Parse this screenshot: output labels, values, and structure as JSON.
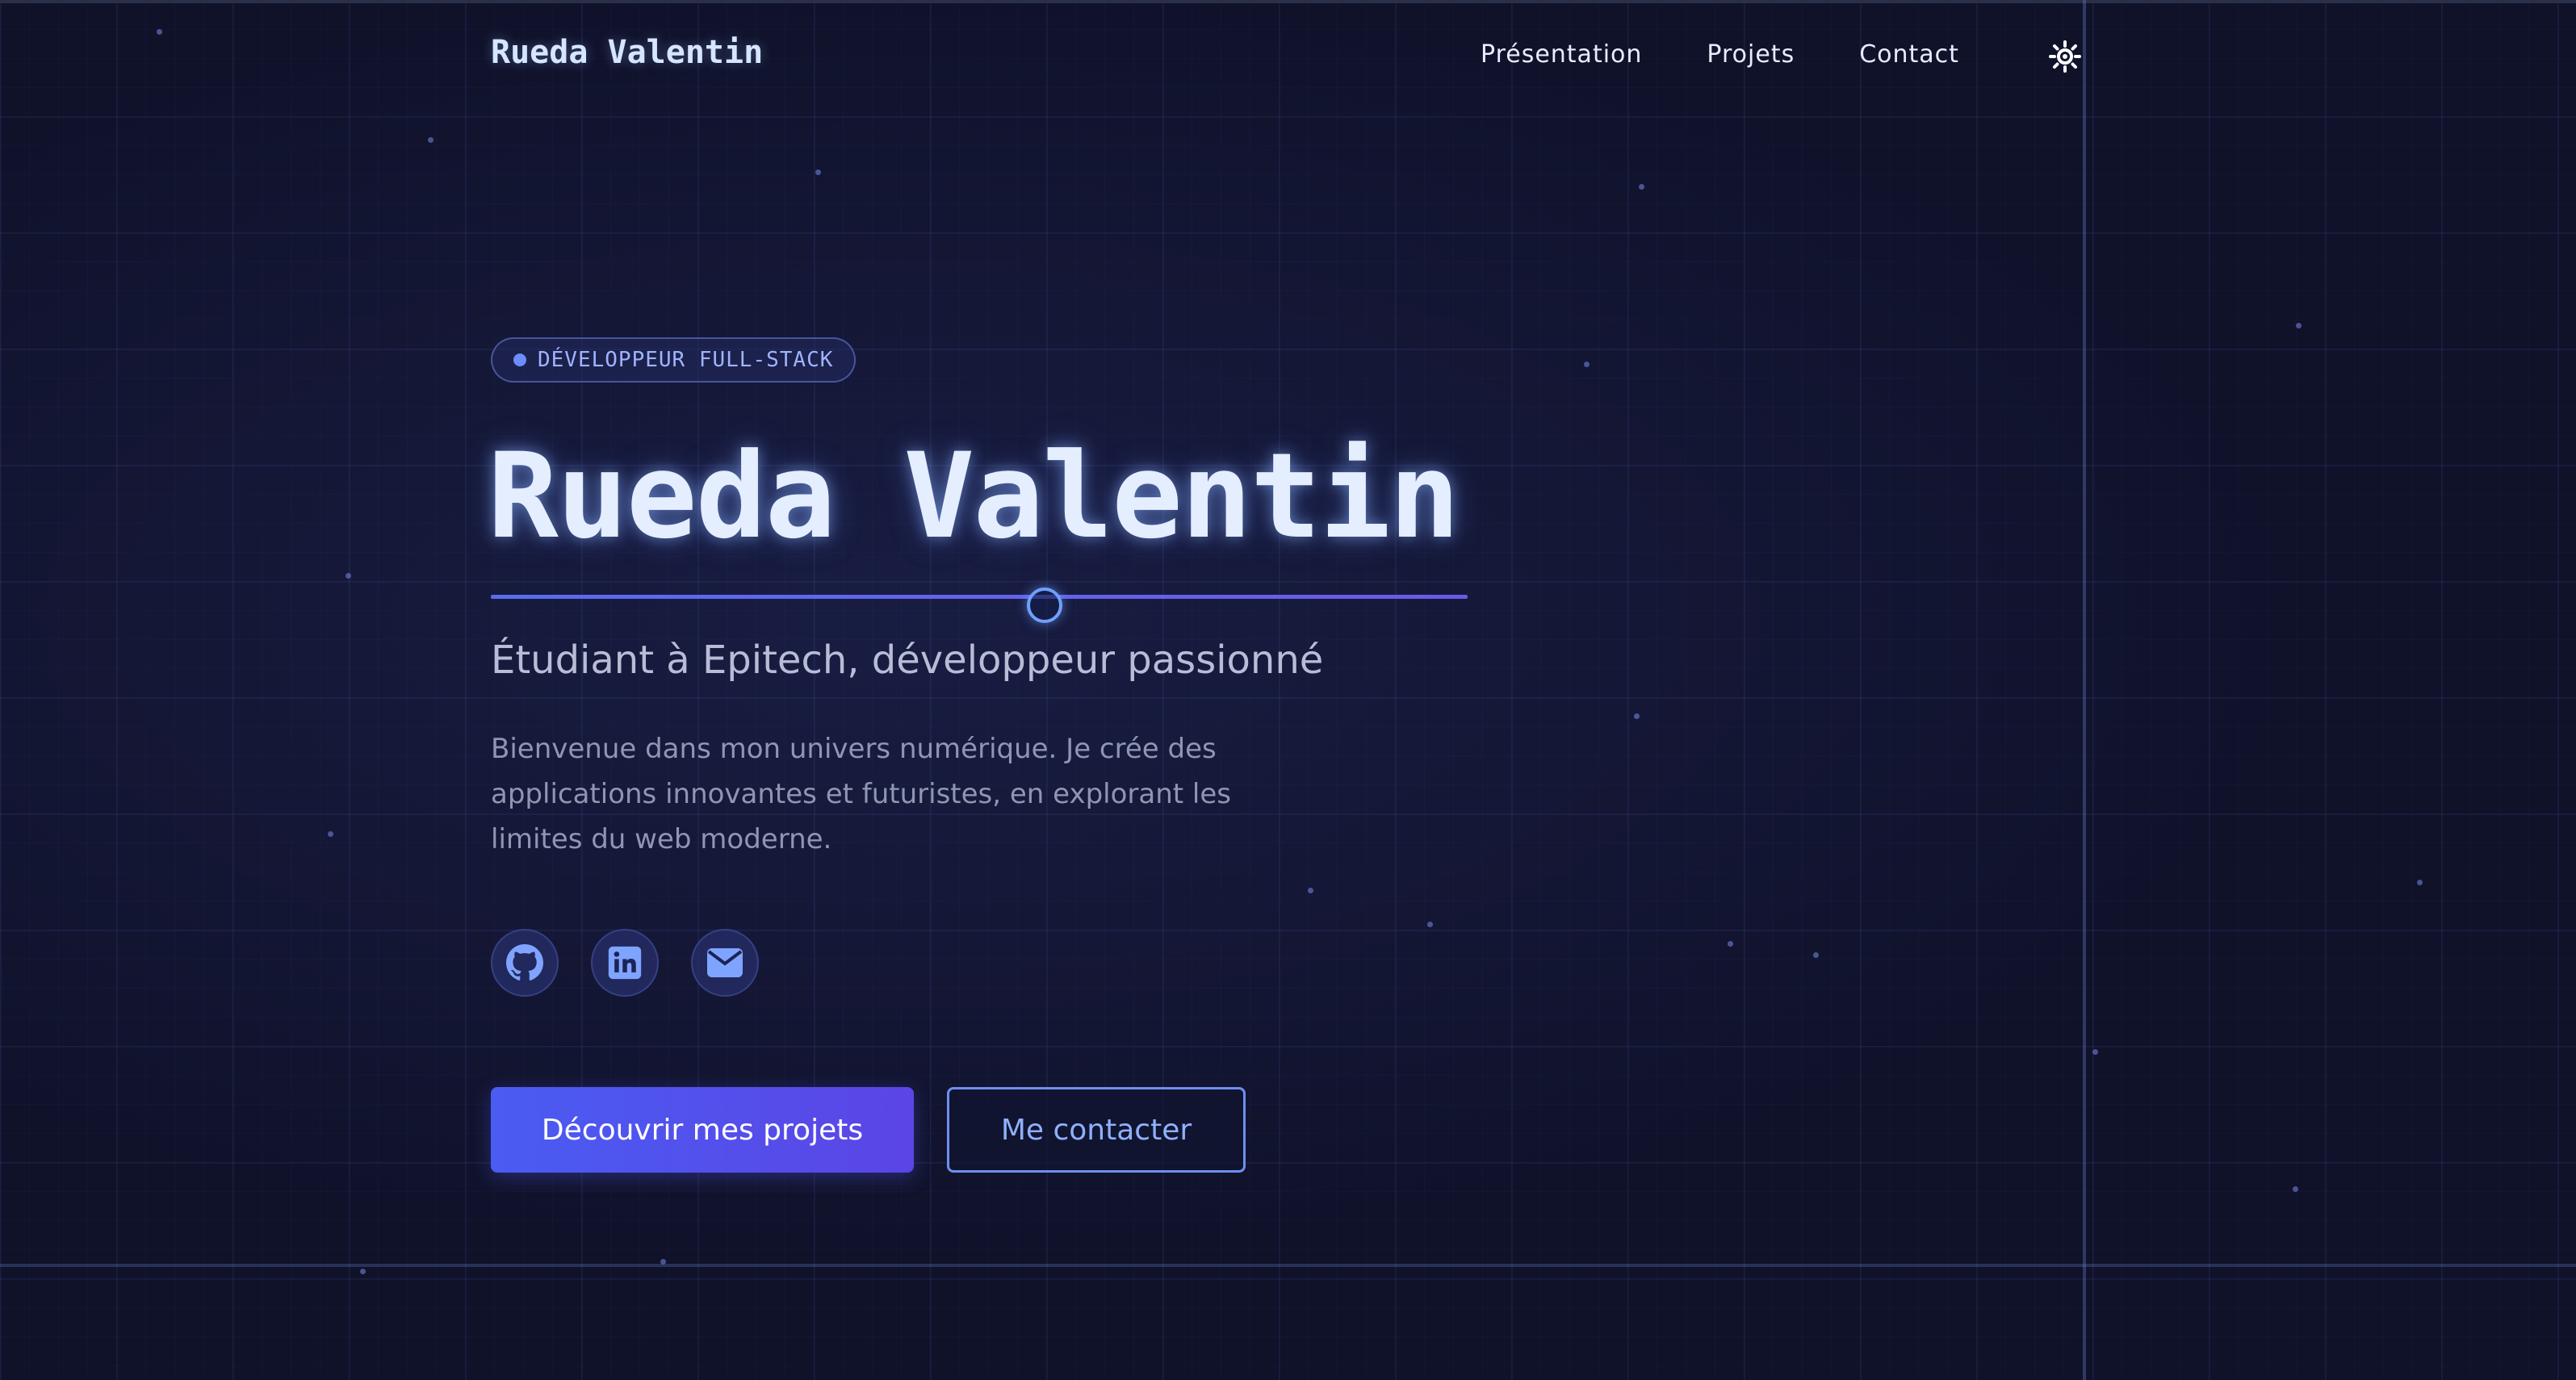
{
  "header": {
    "logo": "Rueda Valentin",
    "nav": [
      {
        "label": "Présentation"
      },
      {
        "label": "Projets"
      },
      {
        "label": "Contact"
      }
    ],
    "theme_toggle_icon": "sun-icon"
  },
  "hero": {
    "badge": "DÉVELOPPEUR FULL-STACK",
    "title": "Rueda Valentin",
    "subtitle": "Étudiant à Epitech, développeur passionné",
    "intro": "Bienvenue dans mon univers numérique. Je crée des applications innovantes et futuristes, en explorant les limites du web moderne.",
    "socials": [
      {
        "icon": "github-icon"
      },
      {
        "icon": "linkedin-icon"
      },
      {
        "icon": "email-icon"
      }
    ],
    "primary_button": "Découvrir mes projets",
    "secondary_button": "Me contacter"
  },
  "colors": {
    "background": "#10122a",
    "accent": "#5a6cf0",
    "title_text": "#e4eeff",
    "link_accent": "#8fb0ff"
  }
}
